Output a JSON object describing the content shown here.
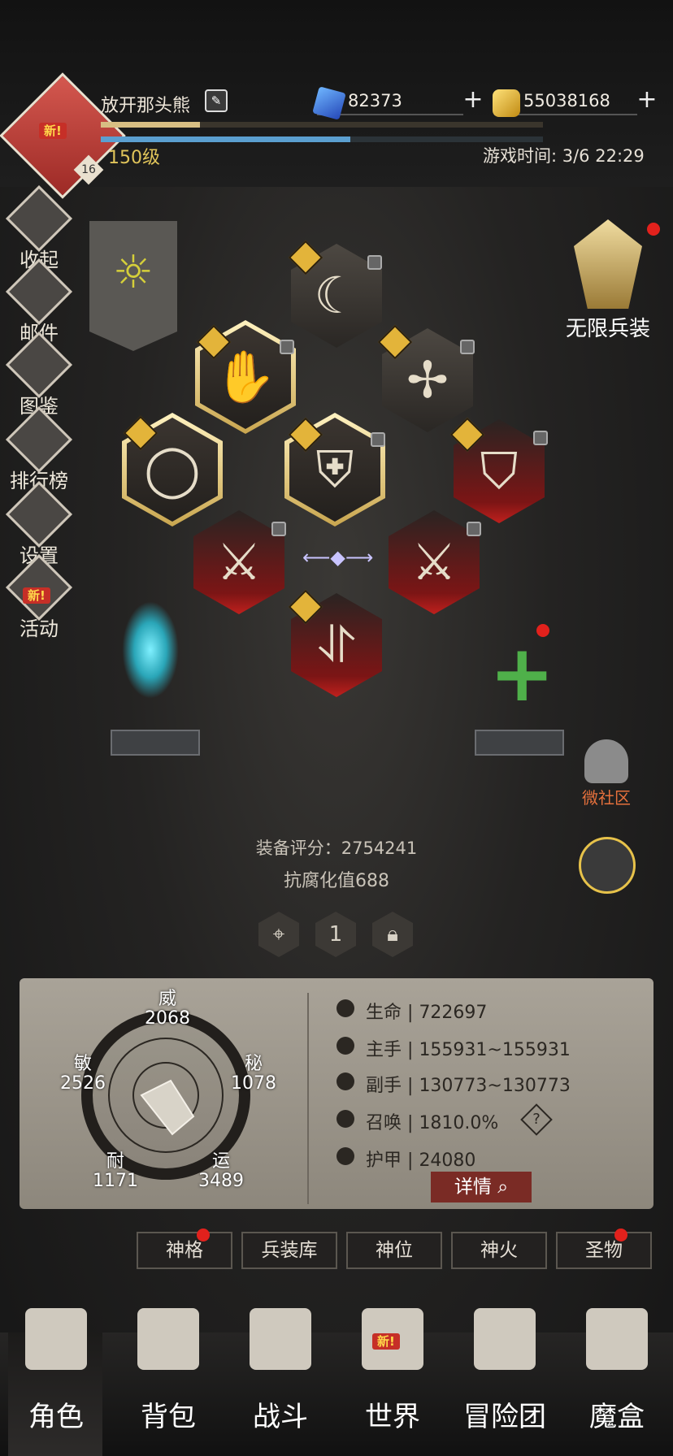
{
  "player": {
    "name": "放开那头熊",
    "level_text": "150级",
    "avatar_badge_level": "16",
    "new_tag": "新!",
    "exp_progress": 0.225,
    "hp_progress": 0.565
  },
  "currency": {
    "diamonds": "82373",
    "gold": "55038168"
  },
  "game_time": "游戏时间: 3/6 22:29",
  "left_menu": [
    {
      "label": "收起"
    },
    {
      "label": "邮件"
    },
    {
      "label": "图鉴"
    },
    {
      "label": "排行榜"
    },
    {
      "label": "设置"
    },
    {
      "label": "活动"
    }
  ],
  "right": {
    "infinite_weapon": "无限兵装",
    "community": "微社区"
  },
  "equip": {
    "score": "装备评分：2754241",
    "corruption": "抗腐化值688",
    "slot_number": "1"
  },
  "attributes": {
    "wei": {
      "name": "威",
      "value": "2068"
    },
    "mi": {
      "name": "秘",
      "value": "1078"
    },
    "yun": {
      "name": "运",
      "value": "3489"
    },
    "nai": {
      "name": "耐",
      "value": "1171"
    },
    "min": {
      "name": "敏",
      "value": "2526"
    }
  },
  "stats": [
    {
      "label": "生命",
      "value": "722697"
    },
    {
      "label": "主手",
      "value": "155931~155931"
    },
    {
      "label": "副手",
      "value": "130773~130773"
    },
    {
      "label": "召唤",
      "value": "1810.0%"
    },
    {
      "label": "护甲",
      "value": "24080"
    }
  ],
  "stat_separator": "|",
  "details_button": "详情",
  "tabs": [
    "神格",
    "兵装库",
    "神位",
    "神火",
    "圣物"
  ],
  "nav": [
    "角色",
    "背包",
    "战斗",
    "世界",
    "冒险团",
    "魔盒"
  ],
  "colors": {
    "accent_gold": "#e0c45a",
    "danger_red": "#c0201d",
    "panel": "#a9a398"
  }
}
